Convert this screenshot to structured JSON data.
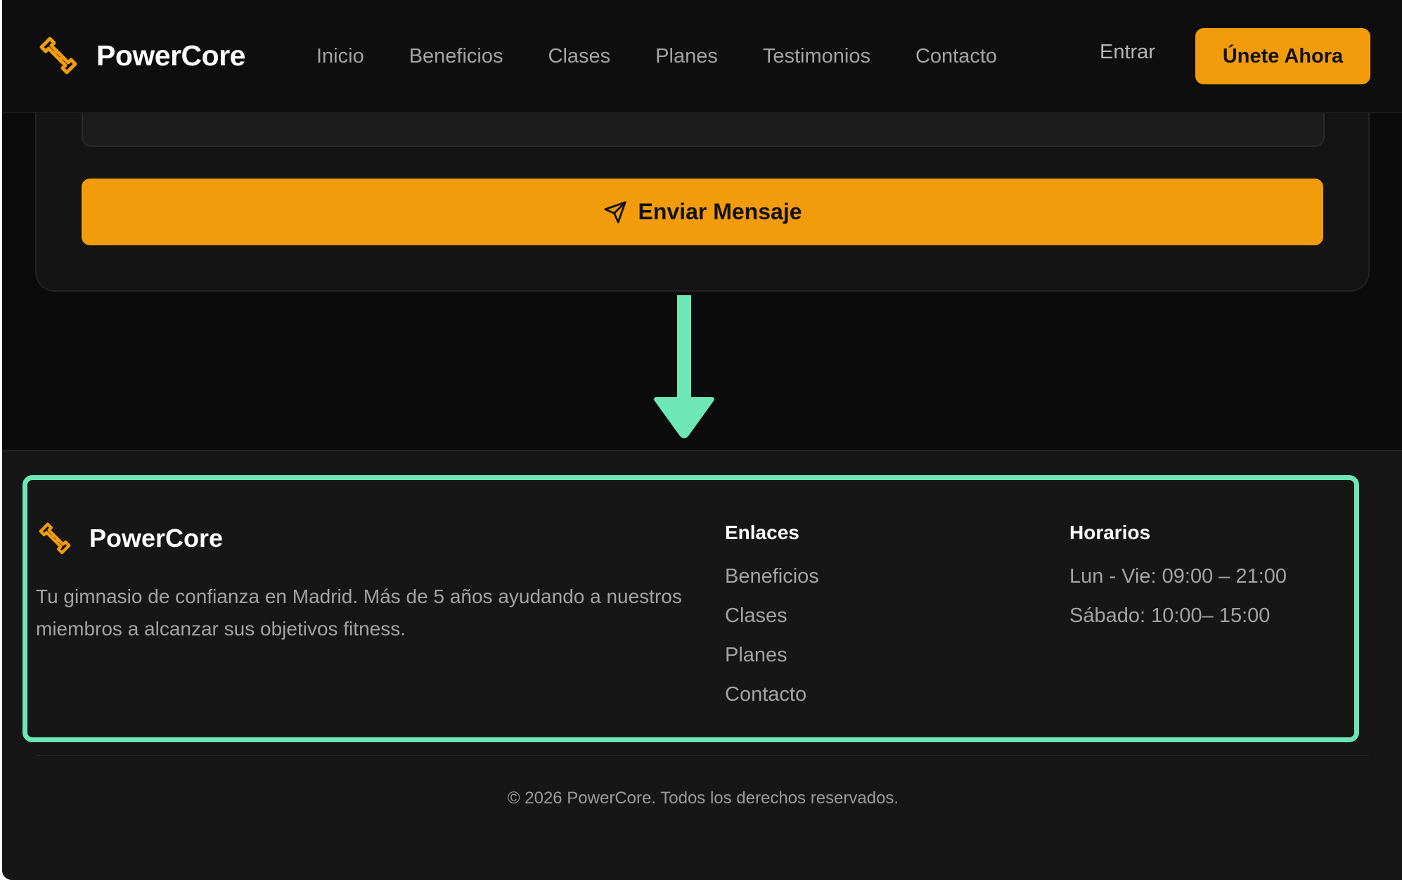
{
  "header": {
    "brand": "PowerCore",
    "nav": [
      "Inicio",
      "Beneficios",
      "Clases",
      "Planes",
      "Testimonios",
      "Contacto"
    ],
    "login_label": "Entrar",
    "cta_label": "Únete Ahora"
  },
  "contact_form": {
    "submit_label": "Enviar Mensaje",
    "submit_icon": "send-icon"
  },
  "footer": {
    "brand": "PowerCore",
    "description": "Tu gimnasio de confianza en Madrid. Más de 5 años ayudando a nuestros miembros a alcanzar sus objetivos fitness.",
    "links_title": "Enlaces",
    "links": [
      "Beneficios",
      "Clases",
      "Planes",
      "Contacto"
    ],
    "hours_title": "Horarios",
    "hours": [
      "Lun - Vie: 09:00 – 21:00",
      "Sábado: 10:00– 15:00"
    ],
    "copyright": "© 2026 PowerCore. Todos los derechos reservados."
  },
  "annotation": {
    "type": "arrow-down",
    "highlight": "footer-main"
  },
  "colors": {
    "accent": "#f39c0b",
    "annotation": "#6ee7b7",
    "background": "#0b0b0b",
    "footer_bg": "#161616",
    "muted_text": "#a3a3a3"
  },
  "icons": {
    "logo": "dumbbell-icon",
    "send": "send-icon",
    "arrow": "arrow-down-icon"
  }
}
